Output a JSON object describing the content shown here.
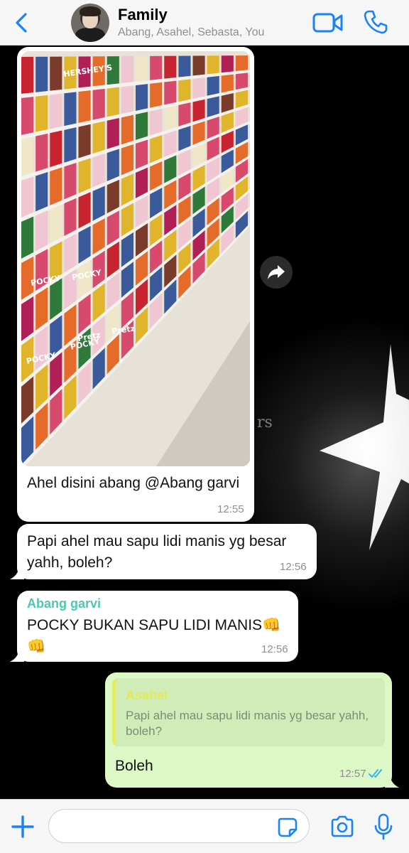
{
  "header": {
    "title": "Family",
    "subtitle": "Abang, Asahel, Sebasta, You",
    "accent_color": "#1a82fb"
  },
  "background": {
    "overlay_text": "rs"
  },
  "messages": [
    {
      "type": "image",
      "direction": "incoming",
      "image_labels": [
        "HERSHEY'S",
        "POCKY",
        "POCKY",
        "POCKY",
        "POCKY",
        "Pretz",
        "Pretz"
      ],
      "caption": "Ahel disini abang @Abang garvi",
      "time": "12:55"
    },
    {
      "type": "text",
      "direction": "incoming",
      "text": "Papi ahel mau sapu lidi manis yg besar yahh, boleh?",
      "time": "12:56"
    },
    {
      "type": "text",
      "direction": "incoming",
      "sender": "Abang garvi",
      "sender_color": "#4fc7b1",
      "text": "POCKY BUKAN SAPU LIDI MANIS👊 👊",
      "time": "12:56"
    },
    {
      "type": "reply",
      "direction": "outgoing",
      "quoted_sender": "Asahel",
      "quoted_text": "Papi ahel mau sapu lidi manis yg besar yahh, boleh?",
      "text": "Boleh",
      "time": "12:57",
      "status": "read"
    }
  ],
  "input": {
    "placeholder": "",
    "value": ""
  }
}
